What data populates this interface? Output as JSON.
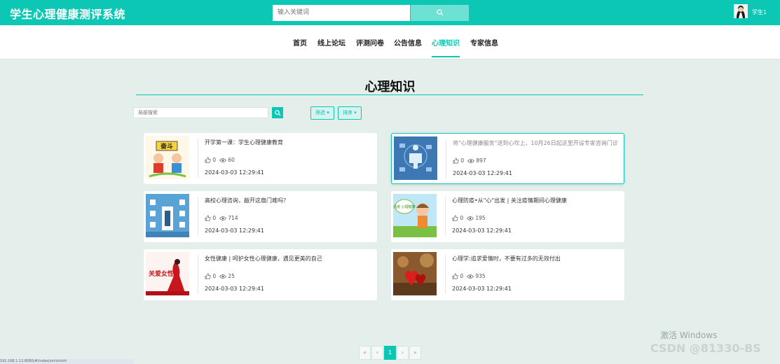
{
  "header": {
    "app_title": "学生心理健康测评系统",
    "search_placeholder": "输入关键词",
    "user_name": "学生1"
  },
  "nav": {
    "items": [
      {
        "label": "首页"
      },
      {
        "label": "线上论坛"
      },
      {
        "label": "评测问卷"
      },
      {
        "label": "公告信息"
      },
      {
        "label": "心理知识",
        "active": true
      },
      {
        "label": "专家信息"
      }
    ]
  },
  "section": {
    "title": "心理知识",
    "local_search_placeholder": "局部搜索",
    "filter_label": "筛选",
    "sort_label": "排序"
  },
  "articles": [
    {
      "title": "开学第一课：学生心理健康教育",
      "likes": "0",
      "views": "60",
      "date": "2024-03-03 12:29:41"
    },
    {
      "title": "将\"心理健康服务\"送到心坎上，10月26日起这里开设专家咨询门诊",
      "likes": "0",
      "views": "897",
      "date": "2024-03-03 12:29:41"
    },
    {
      "title": "高校心理咨询，敲开这扇门难吗？",
      "likes": "0",
      "views": "714",
      "date": "2024-03-03 12:29:41"
    },
    {
      "title": "心理防疫•从\"心\"出发 | 关注疫情期间心理健康",
      "likes": "0",
      "views": "195",
      "date": "2024-03-03 12:29:41"
    },
    {
      "title": "女性健康 | 呵护女性心理健康，遇见更美的自己",
      "likes": "0",
      "views": "25",
      "date": "2024-03-03 12:29:41"
    },
    {
      "title": "心理学:追求爱情时，不要有过多的无效付出",
      "likes": "0",
      "views": "935",
      "date": "2024-03-03 12:29:41"
    }
  ],
  "thumbnails": {
    "t1_text": "奋斗",
    "t4_text": "抗疫 心理健康",
    "t5_text": "关爱女性"
  },
  "pagination": {
    "first": "«",
    "prev": "‹",
    "current": "1",
    "next": "›",
    "last": "»"
  },
  "watermarks": {
    "windows": "激活 Windows",
    "csdn": "CSDN @81330-BS",
    "status_url": "192.168.1.12:8080/#/index/xinlizhishi"
  },
  "colors": {
    "accent": "#0cc7b3",
    "background": "#e4eeeb"
  }
}
